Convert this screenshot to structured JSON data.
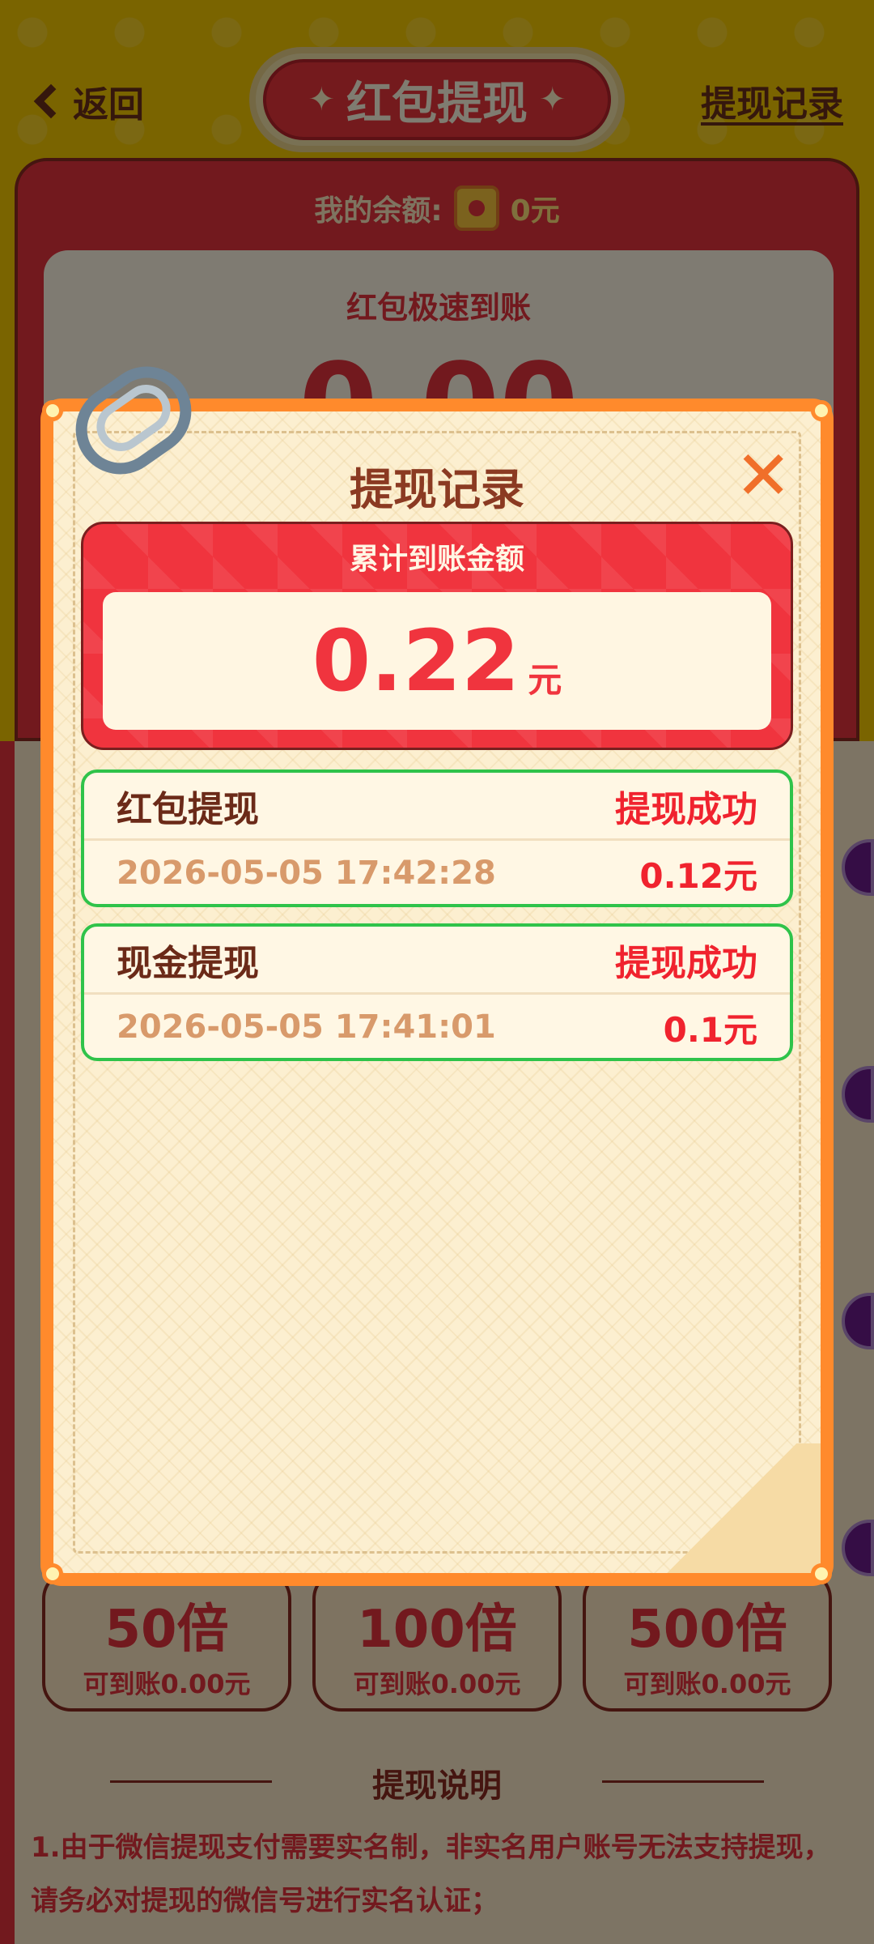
{
  "header": {
    "back_label": "返回",
    "title": "红包提现",
    "records_link": "提现记录"
  },
  "balance": {
    "label": "我的余额:",
    "value": "0元"
  },
  "main_card": {
    "speed_text": "红包极速到账",
    "amount": "0.00"
  },
  "multipliers": [
    {
      "title": "50倍",
      "subtitle": "可到账0.00元"
    },
    {
      "title": "100倍",
      "subtitle": "可到账0.00元"
    },
    {
      "title": "500倍",
      "subtitle": "可到账0.00元"
    }
  ],
  "explain": {
    "title": "提现说明",
    "text": "1.由于微信提现支付需要实名制，非实名用户账号无法支持提现，请务必对提现的微信号进行实名认证；"
  },
  "modal": {
    "title": "提现记录",
    "close_glyph": "✕",
    "total_label": "累计到账金额",
    "total_value": "0.22",
    "total_unit": "元",
    "records": [
      {
        "type": "红包提现",
        "status": "提现成功",
        "time": "2026-05-05 17:42:28",
        "amount": "0.12元"
      },
      {
        "type": "现金提现",
        "status": "提现成功",
        "time": "2026-05-05 17:41:01",
        "amount": "0.1元"
      }
    ]
  },
  "colors": {
    "accent_red": "#f0343e",
    "success_green": "#2fc34a",
    "modal_orange": "#ff8a2c"
  }
}
